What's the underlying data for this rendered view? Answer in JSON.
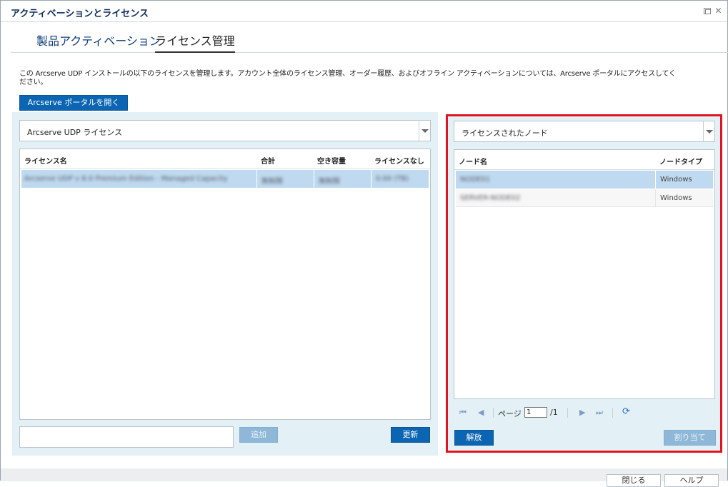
{
  "window": {
    "title": "アクティベーションとライセンス"
  },
  "tabs": [
    {
      "label": "製品アクティベーション"
    },
    {
      "label": "ライセンス管理"
    }
  ],
  "description": "この Arcserve UDP インストールの以下のライセンスを管理します。アカウント全体のライセンス管理、オーダー履歴、およびオフライン アクティベーションについては、Arcserve ポータルにアクセスしてください。",
  "portal_button": "Arcserve ポータルを開く",
  "left": {
    "combo_value": "Arcserve UDP ライセンス",
    "columns": [
      "ライセンス名",
      "合計",
      "空き容量",
      "ライセンスなし"
    ],
    "rows": [
      {
        "name": "Arcserve UDP v 8.0 Premium Edition - Managed Capacity",
        "total": "無制限",
        "free": "無制限",
        "none": "0.00 (TB)"
      }
    ],
    "input_value": "",
    "add_button": "追加",
    "refresh_button": "更新"
  },
  "right": {
    "combo_value": "ライセンスされたノード",
    "columns": [
      "ノード名",
      "ノードタイプ"
    ],
    "rows": [
      {
        "name": "NODE01",
        "type": "Windows"
      },
      {
        "name": "SERVER-NODE02",
        "type": "Windows"
      }
    ],
    "pager": {
      "page_label": "ページ",
      "page_value": "1",
      "total": "/1"
    },
    "release_button": "解放",
    "assign_button": "割り当て"
  },
  "footer": {
    "close_button": "閉じる",
    "help_button": "ヘルプ"
  },
  "colors": {
    "accent": "#0b65b3",
    "highlight_border": "#e0151f",
    "panel_bg": "#e3f0f5",
    "selected_row": "#bfdaf0"
  }
}
